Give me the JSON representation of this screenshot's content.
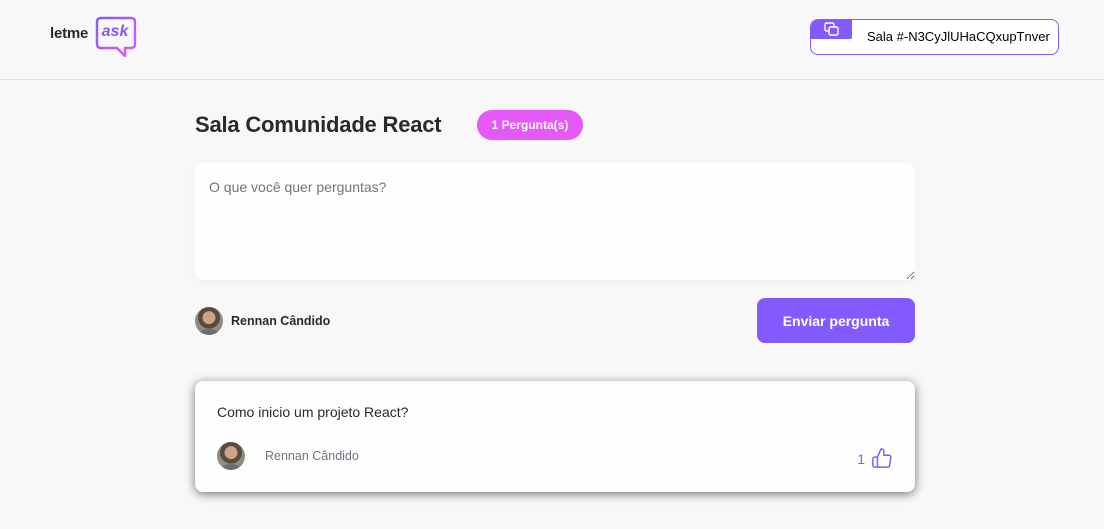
{
  "header": {
    "logo": {
      "text": "letme",
      "accent": "ask"
    },
    "room_code": {
      "label": "Sala #-N3CyJlUHaCQxupTnver",
      "icon": "copy-icon"
    }
  },
  "room": {
    "title": "Sala Comunidade React",
    "question_count_badge": "1 Pergunta(s)"
  },
  "form": {
    "placeholder": "O que você quer perguntas?",
    "value": "",
    "user": {
      "name": "Rennan Cândido",
      "avatar": "user-avatar"
    },
    "submit_label": "Enviar pergunta"
  },
  "questions": [
    {
      "content": "Como inicio um projeto React?",
      "author": "Rennan Cândido",
      "likes": "1",
      "like_icon": "thumbs-up-icon"
    }
  ],
  "colors": {
    "brand": "#835afd",
    "badge": "#e559f9",
    "background": "#f8f8f8",
    "text": "#29292e",
    "muted": "#737380"
  }
}
